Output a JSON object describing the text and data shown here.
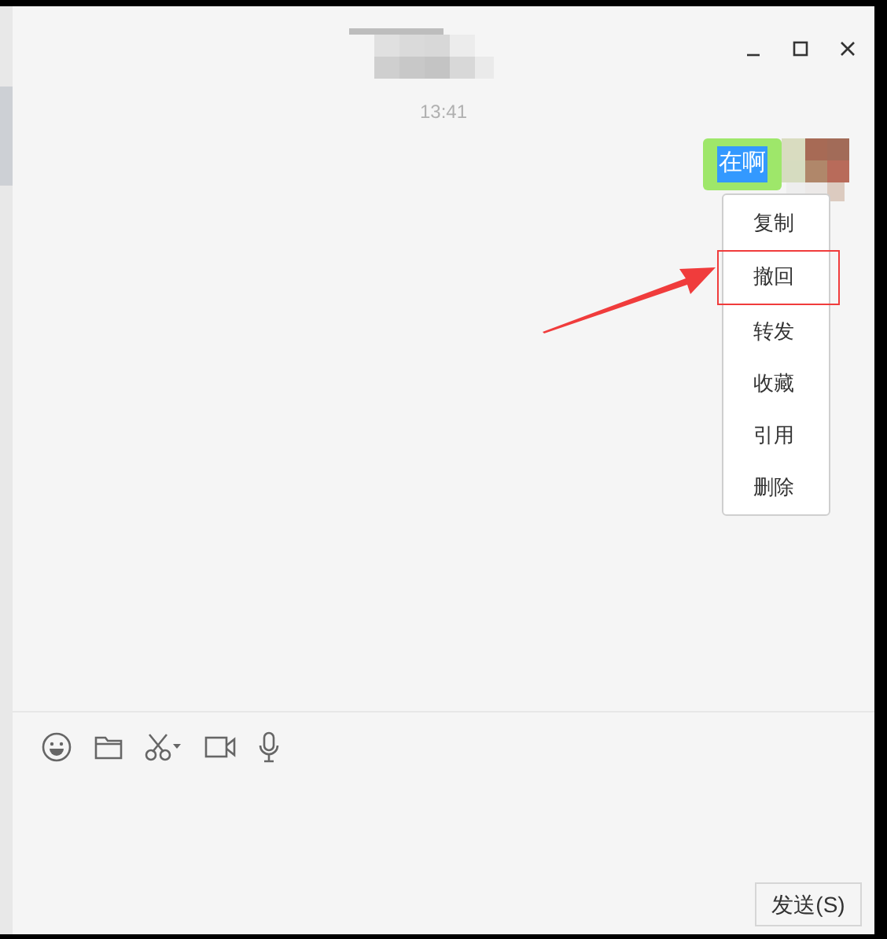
{
  "chat": {
    "timestamp": "13:41",
    "messages": [
      {
        "text": "在啊",
        "outgoing": true,
        "text_selected": true
      }
    ]
  },
  "context_menu": {
    "items": [
      {
        "label": "复制",
        "annotated": false
      },
      {
        "label": "撤回",
        "annotated": true
      },
      {
        "label": "转发",
        "annotated": false
      },
      {
        "label": "收藏",
        "annotated": false
      },
      {
        "label": "引用",
        "annotated": false
      },
      {
        "label": "删除",
        "annotated": false
      }
    ]
  },
  "toolbar": {
    "tools": [
      {
        "kind": "emoji"
      },
      {
        "kind": "folder"
      },
      {
        "kind": "screenshot"
      },
      {
        "kind": "video"
      },
      {
        "kind": "voice"
      }
    ]
  },
  "send_button": {
    "label": "发送(S)"
  }
}
